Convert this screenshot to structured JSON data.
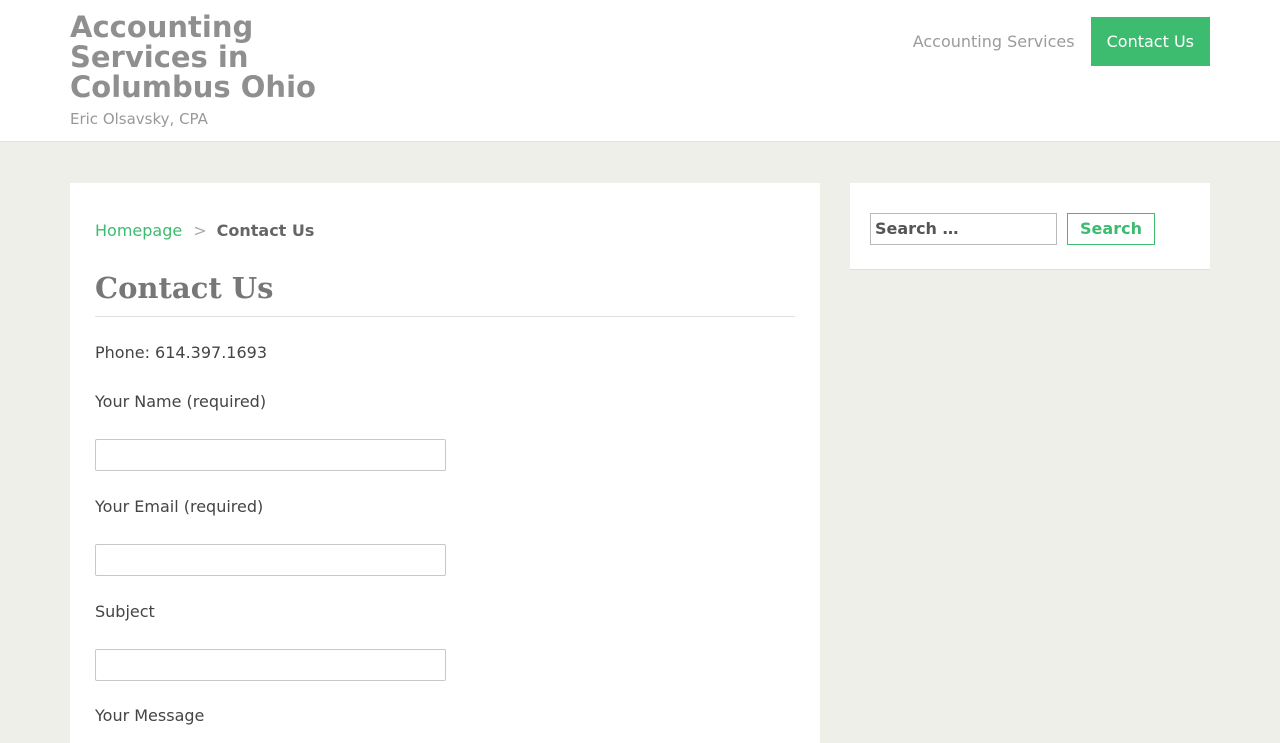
{
  "header": {
    "site_title": "Accounting Services in Columbus Ohio",
    "tagline": "Eric Olsavsky, CPA",
    "nav": [
      {
        "label": "Accounting Services",
        "active": false
      },
      {
        "label": "Contact Us",
        "active": true
      }
    ]
  },
  "breadcrumb": {
    "home": "Homepage",
    "separator": ">",
    "current": "Contact Us"
  },
  "page": {
    "title": "Contact Us",
    "phone": "Phone: 614.397.1693"
  },
  "form": {
    "name_label": "Your Name (required)",
    "name_value": "",
    "email_label": "Your Email (required)",
    "email_value": "",
    "subject_label": "Subject",
    "subject_value": "",
    "message_label": "Your Message"
  },
  "sidebar": {
    "search_placeholder": "Search …",
    "search_button": "Search"
  },
  "colors": {
    "accent": "#3dbb6f",
    "page_background": "#efefea"
  }
}
